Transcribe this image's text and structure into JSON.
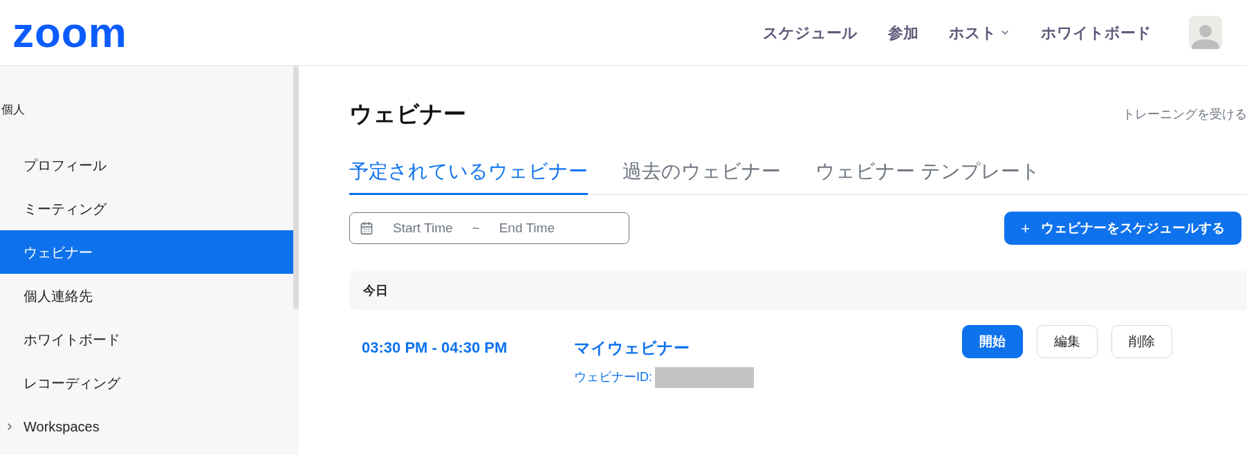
{
  "header": {
    "logo": "zoom",
    "nav": [
      {
        "label": "スケジュール",
        "kind": "link"
      },
      {
        "label": "参加",
        "kind": "link"
      },
      {
        "label": "ホスト",
        "kind": "dropdown"
      },
      {
        "label": "ホワイトボード",
        "kind": "link"
      }
    ]
  },
  "sidebar": {
    "section": "個人",
    "items": [
      {
        "label": "プロフィール",
        "kind": "link",
        "selected": false
      },
      {
        "label": "ミーティング",
        "kind": "link",
        "selected": false
      },
      {
        "label": "ウェビナー",
        "kind": "link",
        "selected": true
      },
      {
        "label": "個人連絡先",
        "kind": "link",
        "selected": false
      },
      {
        "label": "ホワイトボード",
        "kind": "link",
        "selected": false
      },
      {
        "label": "レコーディング",
        "kind": "link",
        "selected": false
      },
      {
        "label": "Workspaces",
        "kind": "group",
        "selected": false
      }
    ]
  },
  "page": {
    "title": "ウェビナー",
    "training_link": "トレーニングを受ける",
    "tabs": [
      {
        "label": "予定されているウェビナー",
        "selected": true
      },
      {
        "label": "過去のウェビナー",
        "selected": false
      },
      {
        "label": "ウェビナー テンプレート",
        "selected": false
      }
    ],
    "date_range": {
      "start_placeholder": "Start Time",
      "separator": "~",
      "end_placeholder": "End Time"
    },
    "schedule_button": {
      "icon": "+",
      "label": "ウェビナーをスケジュールする"
    },
    "groups": [
      {
        "heading": "今日",
        "webinars": [
          {
            "time": "03:30 PM - 04:30 PM",
            "title": "マイウェビナー",
            "id_label": "ウェビナーID:",
            "actions": [
              {
                "label": "開始",
                "kind": "primary"
              },
              {
                "label": "編集",
                "kind": "secondary"
              },
              {
                "label": "削除",
                "kind": "secondary"
              }
            ]
          }
        ]
      }
    ]
  }
}
